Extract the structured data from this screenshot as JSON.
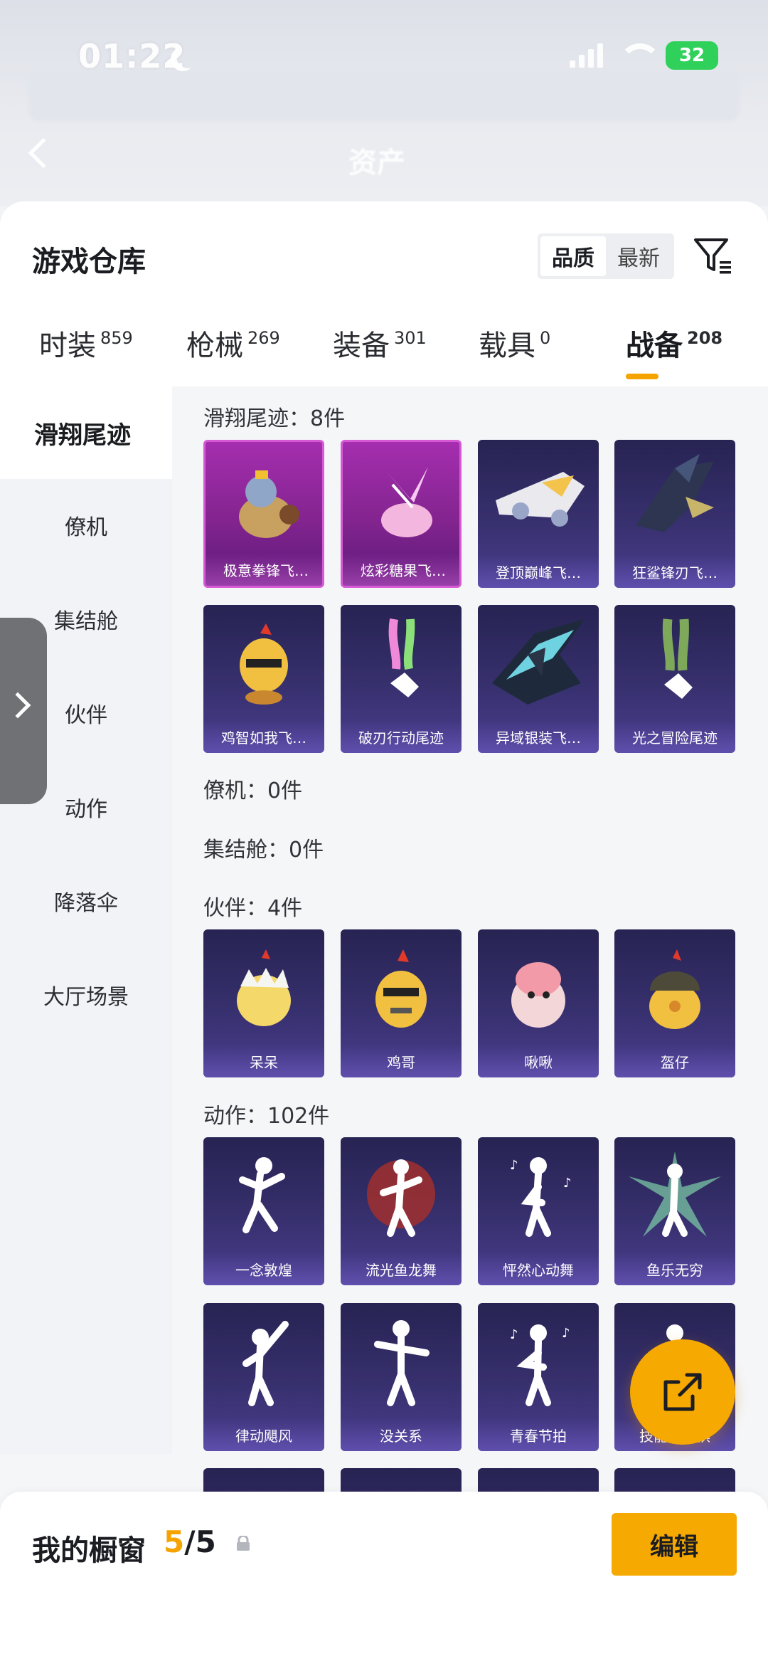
{
  "status_bar": {
    "time": "01:22",
    "battery": "32"
  },
  "background_header": {
    "title": "资产"
  },
  "warehouse": {
    "title": "游戏仓库",
    "sort_options": [
      "品质",
      "最新"
    ],
    "active_sort": "品质"
  },
  "tabs": [
    {
      "label": "时装",
      "count": "859"
    },
    {
      "label": "枪械",
      "count": "269"
    },
    {
      "label": "装备",
      "count": "301"
    },
    {
      "label": "载具",
      "count": "0"
    },
    {
      "label": "战备",
      "count": "208"
    }
  ],
  "active_tab": "战备",
  "categories": [
    "滑翔尾迹",
    "僚机",
    "集结舱",
    "伙伴",
    "动作",
    "降落伞",
    "大厅场景"
  ],
  "sections": {
    "glide": {
      "title": "滑翔尾迹：8件",
      "items": [
        "极意拳锋飞…",
        "炫彩糖果飞…",
        "登顶巅峰飞…",
        "狂鲨锋刃飞…",
        "鸡智如我飞…",
        "破刃行动尾迹",
        "异域银装飞…",
        "光之冒险尾迹"
      ]
    },
    "wingman": {
      "title": "僚机：0件"
    },
    "capsule": {
      "title": "集结舱：0件"
    },
    "partner": {
      "title": "伙伴：4件",
      "items": [
        "呆呆",
        "鸡哥",
        "啾啾",
        "盔仔"
      ]
    },
    "emote": {
      "title": "动作：102件",
      "items": [
        "一念敦煌",
        "流光鱼龙舞",
        "怦然心动舞",
        "鱼乐无穷",
        "律动飓风",
        "没关系",
        "青春节拍",
        "技能五子棋"
      ]
    }
  },
  "showcase": {
    "title": "我的橱窗",
    "current": "5",
    "total": "/5",
    "edit_label": "编辑"
  },
  "colors": {
    "accent": "#f6a900",
    "card_purple": "#37306e",
    "card_pink": "#a52eaf"
  }
}
